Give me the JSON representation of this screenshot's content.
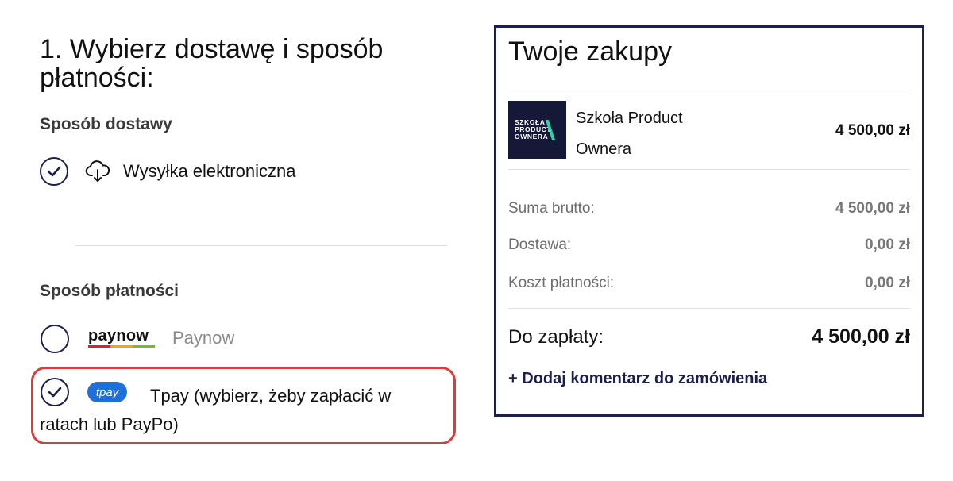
{
  "delivery_step": {
    "title": "1. Wybierz dostawę i sposób płatności:",
    "delivery_heading": "Sposób dostawy",
    "delivery_option": {
      "label": "Wysyłka elektroniczna",
      "icon": "cloud-download-icon",
      "selected": true
    },
    "payment_heading": "Sposób płatności",
    "payment_options": [
      {
        "logo_text": "paynow",
        "label": "Paynow",
        "selected": false
      },
      {
        "logo_text": "tpay",
        "label": "Tpay (wybierz, żeby zapłacić w ratach lub PayPo)",
        "selected": true
      }
    ]
  },
  "cart": {
    "title": "Twoje zakupy",
    "product": {
      "thumb_lines": [
        "SZKOŁA",
        "PRODUCT",
        "OWNERA"
      ],
      "name": "Szkoła Product Ownera",
      "price": "4 500,00 zł"
    },
    "summary": [
      {
        "label": "Suma brutto:",
        "value": "4 500,00 zł"
      },
      {
        "label": "Dostawa:",
        "value": "0,00 zł"
      },
      {
        "label": "Koszt płatności:",
        "value": "0,00 zł"
      }
    ],
    "total": {
      "label": "Do zapłaty:",
      "value": "4 500,00 zł"
    },
    "add_comment": "+ Dodaj komentarz do zamówienia"
  },
  "colors": {
    "navy": "#1c1f4a",
    "highlight_border": "#d93c3c",
    "tpay_blue": "#1e6fd9",
    "thumb_bg": "#141937",
    "thumb_accent": "#2fd3b0",
    "paynow_stripes": [
      "#d9232e",
      "#f2a900",
      "#7ab929"
    ]
  }
}
